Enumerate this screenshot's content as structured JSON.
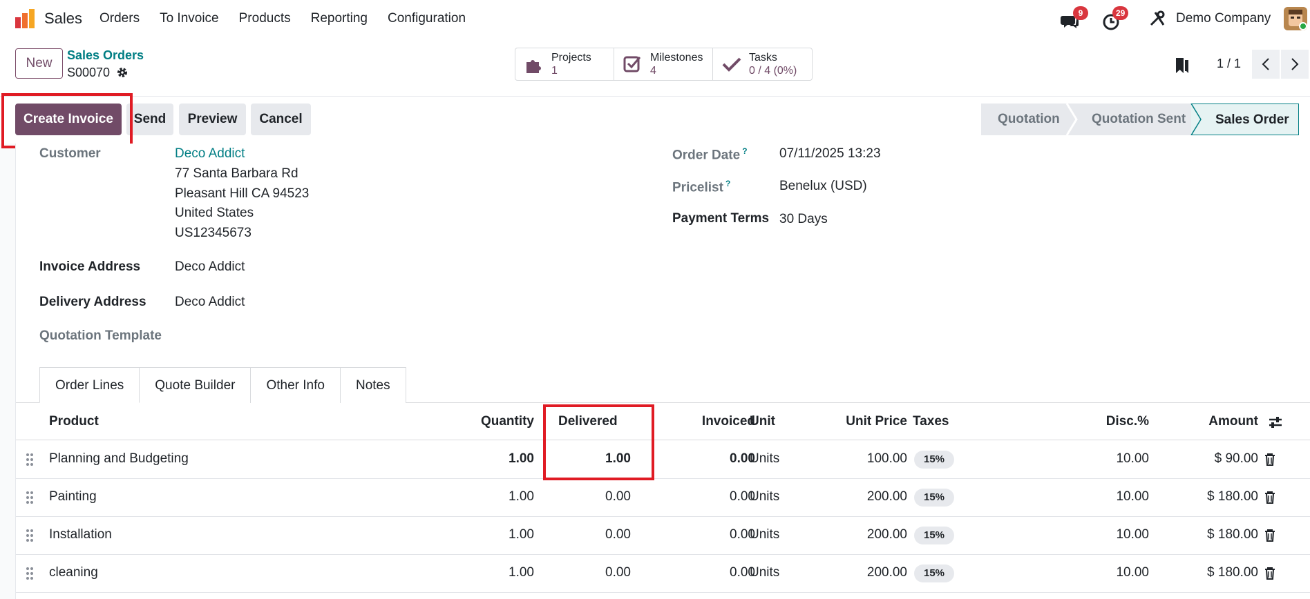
{
  "app": {
    "name": "Sales",
    "logo_colors": [
      "#f06f2e",
      "#f6a623",
      "#d9363e"
    ]
  },
  "menu": [
    "Orders",
    "To Invoice",
    "Products",
    "Reporting",
    "Configuration"
  ],
  "systray": {
    "messages_count": "9",
    "activities_count": "29",
    "company": "Demo Company"
  },
  "control": {
    "new_label": "New",
    "breadcrumb_parent": "Sales Orders",
    "record_name": "S00070",
    "smart_buttons": [
      {
        "label": "Projects",
        "value": "1",
        "icon": "puzzle-icon"
      },
      {
        "label": "Milestones",
        "value": "4",
        "icon": "checkbox-icon"
      },
      {
        "label": "Tasks",
        "value": "0 / 4 (0%)",
        "icon": "check-icon"
      }
    ],
    "pager": "1 / 1"
  },
  "statusbar": {
    "create_invoice": "Create Invoice",
    "send": "Send",
    "preview": "Preview",
    "cancel": "Cancel",
    "stages": [
      "Quotation",
      "Quotation Sent",
      "Sales Order"
    ],
    "active_stage": "Sales Order"
  },
  "form": {
    "customer_label": "Customer",
    "customer_name": "Deco Addict",
    "customer_address": [
      "77 Santa Barbara Rd",
      "Pleasant Hill CA 94523",
      "United States",
      "US12345673"
    ],
    "invoice_address_label": "Invoice Address",
    "invoice_address": "Deco Addict",
    "delivery_address_label": "Delivery Address",
    "delivery_address": "Deco Addict",
    "quotation_template_label": "Quotation Template",
    "order_date_label": "Order Date",
    "order_date": "07/11/2025 13:23",
    "pricelist_label": "Pricelist",
    "pricelist": "Benelux (USD)",
    "payment_terms_label": "Payment Terms",
    "payment_terms": "30 Days",
    "help_mark": "?"
  },
  "tabs": [
    "Order Lines",
    "Quote Builder",
    "Other Info",
    "Notes"
  ],
  "table": {
    "columns": [
      "Product",
      "Quantity",
      "Delivered",
      "Invoiced",
      "Unit",
      "Unit Price",
      "Taxes",
      "Disc.%",
      "Amount"
    ],
    "rows": [
      {
        "product": "Planning and Budgeting",
        "quantity": "1.00",
        "delivered": "1.00",
        "invoiced": "0.00",
        "unit": "Units",
        "unit_price": "100.00",
        "tax": "15%",
        "disc": "10.00",
        "amount": "$ 90.00"
      },
      {
        "product": "Painting",
        "quantity": "1.00",
        "delivered": "0.00",
        "invoiced": "0.00",
        "unit": "Units",
        "unit_price": "200.00",
        "tax": "15%",
        "disc": "10.00",
        "amount": "$ 180.00"
      },
      {
        "product": "Installation",
        "quantity": "1.00",
        "delivered": "0.00",
        "invoiced": "0.00",
        "unit": "Units",
        "unit_price": "200.00",
        "tax": "15%",
        "disc": "10.00",
        "amount": "$ 180.00"
      },
      {
        "product": "cleaning",
        "quantity": "1.00",
        "delivered": "0.00",
        "invoiced": "0.00",
        "unit": "Units",
        "unit_price": "200.00",
        "tax": "15%",
        "disc": "10.00",
        "amount": "$ 180.00"
      }
    ]
  },
  "colors": {
    "primary": "#714b67",
    "link": "#017e84",
    "highlight": "#e01b24"
  }
}
